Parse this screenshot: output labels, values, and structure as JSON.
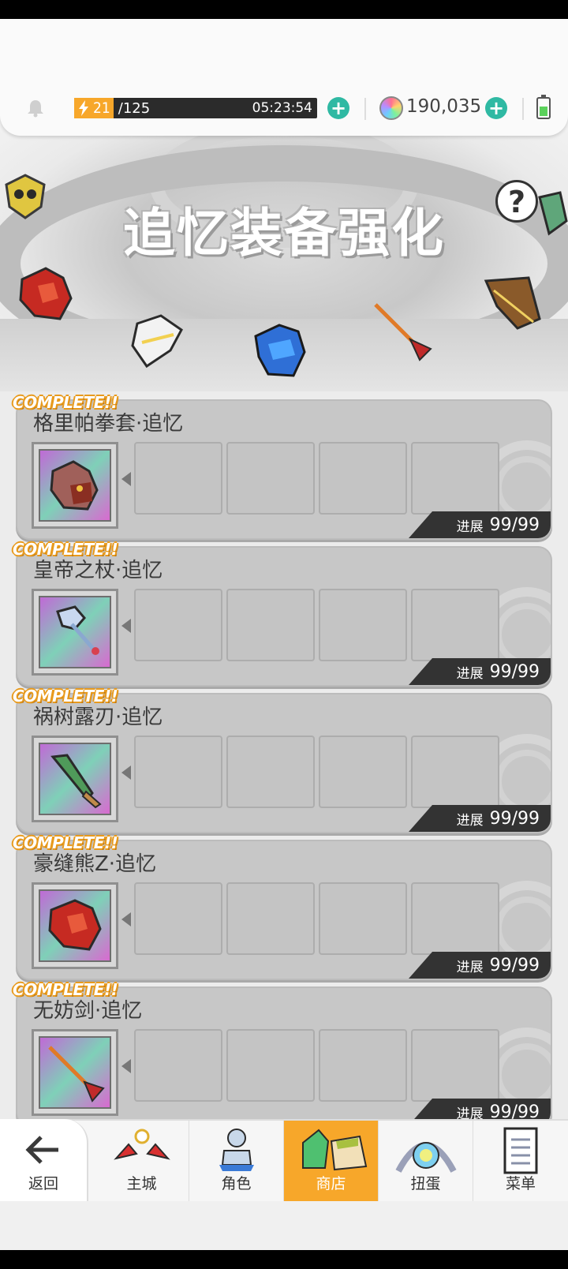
{
  "header": {
    "stamina_current": "21",
    "stamina_max": "/125",
    "stamina_timer": "05:23:54",
    "gems": "190,035"
  },
  "banner": {
    "title": "追忆装备强化",
    "help_label": "?"
  },
  "complete_badge": "COMPLETE!!",
  "progress_label": "进展",
  "items": [
    {
      "name": "格里帕拳套·追忆",
      "progress": "99/99",
      "icon": "gauntlet-icon"
    },
    {
      "name": "皇帝之杖·追忆",
      "progress": "99/99",
      "icon": "scepter-icon"
    },
    {
      "name": "祸树露刃·追忆",
      "progress": "99/99",
      "icon": "green-blade-icon"
    },
    {
      "name": "豪缝熊Z·追忆",
      "progress": "99/99",
      "icon": "red-bear-gauntlet-icon"
    },
    {
      "name": "无妨剑·追忆",
      "progress": "99/99",
      "icon": "red-spear-icon"
    }
  ],
  "nav": {
    "back": "返回",
    "main_city": "主城",
    "character": "角色",
    "shop": "商店",
    "gacha": "扭蛋",
    "menu": "菜单"
  },
  "colors": {
    "accent_orange": "#f7a72a",
    "plus_teal": "#2fb9a3",
    "progress_bg": "#333333"
  }
}
